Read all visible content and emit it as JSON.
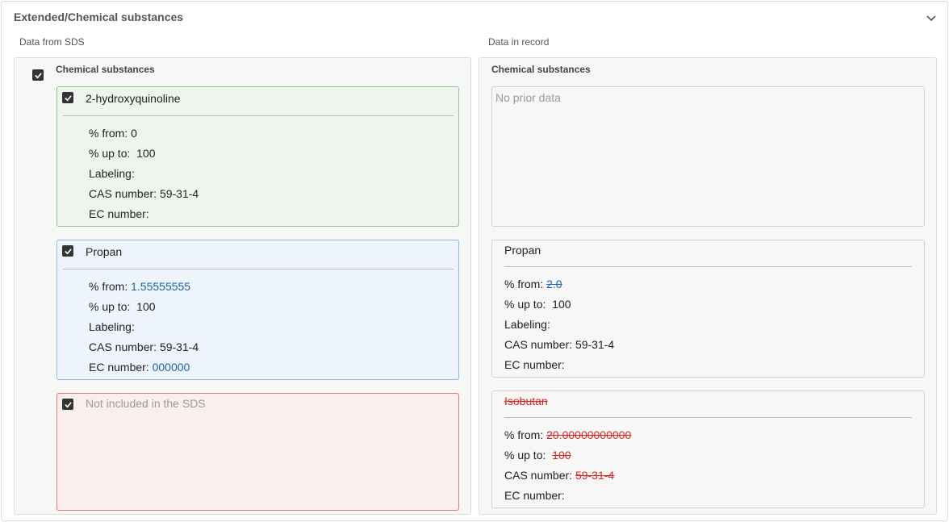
{
  "panel": {
    "title": "Extended/Chemical substances"
  },
  "left": {
    "label": "Data from SDS",
    "section_title": "Chemical substances",
    "cards": [
      {
        "name": "2-hydroxyquinoline",
        "from_label": "% from:",
        "from": "0",
        "upto_label": "% up to:",
        "upto": "100",
        "labeling_label": "Labeling:",
        "cas_label": "CAS number:",
        "cas": "59-31-4",
        "ec_label": "EC number:",
        "ec": ""
      },
      {
        "name": "Propan",
        "from_label": "% from:",
        "from": "1.55555555",
        "upto_label": "% up to:",
        "upto": "100",
        "labeling_label": "Labeling:",
        "cas_label": "CAS number:",
        "cas": "59-31-4",
        "ec_label": "EC number:",
        "ec": "000000"
      },
      {
        "name": "Not included in the SDS"
      }
    ]
  },
  "right": {
    "label": "Data in record",
    "section_title": "Chemical substances",
    "no_data": "No prior data",
    "cards": [
      {
        "name": "Propan",
        "from_label": "% from:",
        "from": "2.0",
        "upto_label": "% up to:",
        "upto": "100",
        "labeling_label": "Labeling:",
        "cas_label": "CAS number:",
        "cas": "59-31-4",
        "ec_label": "EC number:"
      },
      {
        "name": "Isobutan",
        "from_label": "% from:",
        "from": "20.00000000000",
        "upto_label": "% up to:",
        "upto": "100",
        "cas_label": "CAS number:",
        "cas": "59-31-4",
        "ec_label": "EC number:"
      }
    ]
  },
  "icons": {
    "chevron": "chevron-down-icon",
    "check": "check-icon"
  },
  "colors": {
    "added": "#8fc58a",
    "changed": "#8dbbe6",
    "removed": "#e27a7a",
    "changed_text": "#1f63ad",
    "removed_text": "#d62828"
  }
}
